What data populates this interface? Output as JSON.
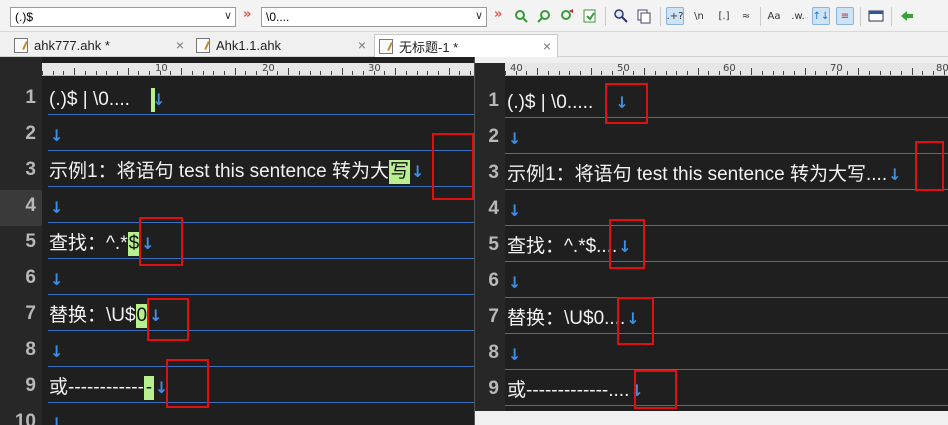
{
  "toolbar": {
    "find_value": "(.)$",
    "replace_value": "\\0....",
    "combo_arrow": "∨",
    "double_arrow": "»",
    "regex_label": ".+?",
    "newline_label": "\\n",
    "set_label": "[.]",
    "approx_label": "≈",
    "case_label": "Aa",
    "word_label": ".w.",
    "updown_label": "↑↓",
    "list_label": "≡"
  },
  "tabs": [
    {
      "label": "ahk777.ahk *",
      "close": "×"
    },
    {
      "label": "Ahk1.1.ahk",
      "close": "×"
    },
    {
      "label": "无标题-1 *",
      "close": "×"
    }
  ],
  "ruler_numbers": [
    "10",
    "20",
    "30",
    "40",
    "50",
    "60",
    "70",
    "80"
  ],
  "left_editor": {
    "line_numbers": [
      "1",
      "2",
      "3",
      "4",
      "5",
      "6",
      "7",
      "8",
      "9",
      "10"
    ],
    "lines": [
      {
        "text": "(.)$   |   \\0....",
        "cursor": ""
      },
      {
        "text": "",
        "cursor": ""
      },
      {
        "text": "示例1：将语句 test this sentence 转为大",
        "cursor": "写"
      },
      {
        "text": "",
        "cursor": ""
      },
      {
        "text": "查找：^.*",
        "cursor": "$"
      },
      {
        "text": "",
        "cursor": ""
      },
      {
        "text": "替换：\\U$",
        "cursor": "0"
      },
      {
        "text": "",
        "cursor": ""
      },
      {
        "text": "或------------",
        "cursor": "-"
      },
      {
        "text": "",
        "cursor": ""
      }
    ],
    "eol_mark": "↓"
  },
  "right_editor": {
    "line_numbers": [
      "1",
      "2",
      "3",
      "4",
      "5",
      "6",
      "7",
      "8",
      "9"
    ],
    "lines": [
      {
        "text": "(.)$   |   \\0....."
      },
      {
        "text": ""
      },
      {
        "text": "示例1：将语句 test this sentence 转为大写...."
      },
      {
        "text": ""
      },
      {
        "text": "查找：^.*$...."
      },
      {
        "text": ""
      },
      {
        "text": "替换：\\U$0...."
      },
      {
        "text": ""
      },
      {
        "text": "或-------------...."
      }
    ],
    "eol_mark": "↓"
  }
}
